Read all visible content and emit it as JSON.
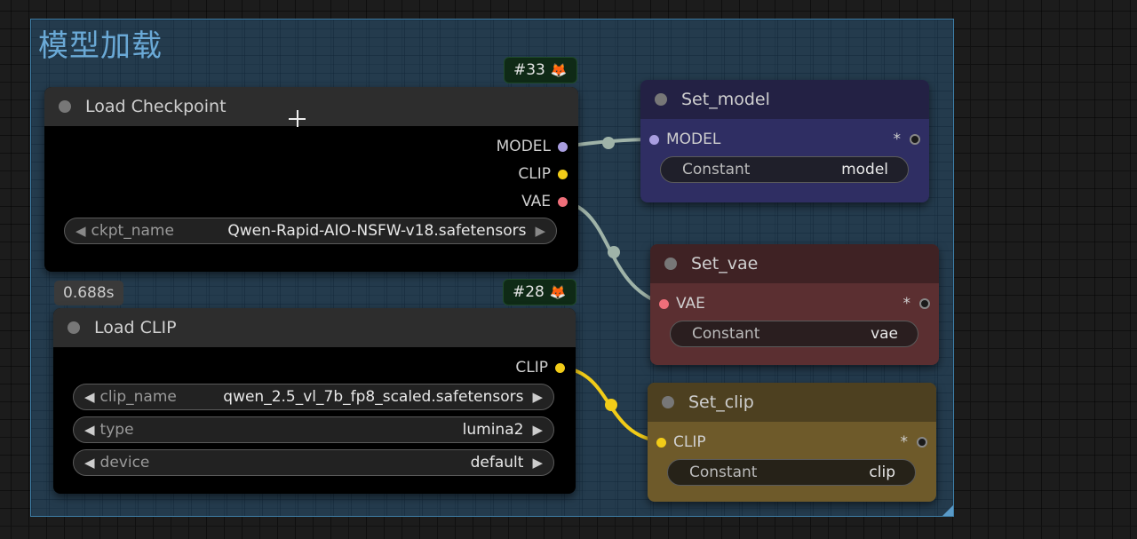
{
  "group": {
    "title": "模型加载"
  },
  "nodes": {
    "load_checkpoint": {
      "title": "Load Checkpoint",
      "badge_id": "#33",
      "outputs": [
        {
          "label": "MODEL",
          "color": "#a99ee0"
        },
        {
          "label": "CLIP",
          "color": "#f2cc18"
        },
        {
          "label": "VAE",
          "color": "#ef6f7a"
        }
      ],
      "ckpt_name": {
        "label": "ckpt_name",
        "value": "Qwen-Rapid-AIO-NSFW-v18.safetensors"
      }
    },
    "load_clip": {
      "title": "Load CLIP",
      "badge_id": "#28",
      "timing": "0.688s",
      "output": {
        "label": "CLIP",
        "color": "#f2cc18"
      },
      "widgets": [
        {
          "label": "clip_name",
          "value": "qwen_2.5_vl_7b_fp8_scaled.safetensors"
        },
        {
          "label": "type",
          "value": "lumina2"
        },
        {
          "label": "device",
          "value": "default"
        }
      ]
    },
    "set_model": {
      "title": "Set_model",
      "input_label": "MODEL",
      "input_color": "#a99ee0",
      "star": "*",
      "widget_label": "Constant",
      "widget_value": "model"
    },
    "set_vae": {
      "title": "Set_vae",
      "input_label": "VAE",
      "input_color": "#ef6f7a",
      "star": "*",
      "widget_label": "Constant",
      "widget_value": "vae"
    },
    "set_clip": {
      "title": "Set_clip",
      "input_label": "CLIP",
      "input_color": "#f2cc18",
      "star": "*",
      "widget_label": "Constant",
      "widget_value": "clip"
    }
  },
  "icons": {
    "left_arrow": "◀",
    "right_arrow": "▶",
    "fox": "🦊"
  },
  "colors": {
    "model_link": "#9fb3a8",
    "vae_link": "#9fb3a8",
    "clip_link": "#f2cc18"
  }
}
